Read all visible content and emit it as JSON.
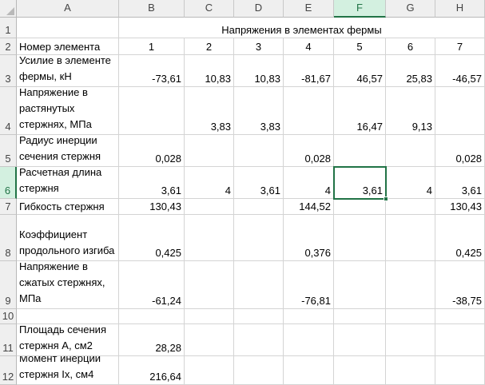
{
  "columns": [
    "A",
    "B",
    "C",
    "D",
    "E",
    "F",
    "G",
    "H"
  ],
  "active_column": "F",
  "active_row": "6",
  "rows": [
    {
      "num": "1",
      "a": "",
      "b": "",
      "c": "",
      "d": "",
      "e": "",
      "f": "",
      "g": "",
      "h": "",
      "merged_title": "Напряжения в элементах фермы"
    },
    {
      "num": "2",
      "a": "Номер элемента",
      "b": "1",
      "c": "2",
      "d": "3",
      "e": "4",
      "f": "5",
      "g": "6",
      "h": "7"
    },
    {
      "num": "3",
      "a": "Усилие в элементе фермы, кН",
      "b": "-73,61",
      "c": "10,83",
      "d": "10,83",
      "e": "-81,67",
      "f": "46,57",
      "g": "25,83",
      "h": "-46,57"
    },
    {
      "num": "4",
      "a": "Напряжение в растянутых стержнях, МПа",
      "b": "",
      "c": "3,83",
      "d": "3,83",
      "e": "",
      "f": "16,47",
      "g": "9,13",
      "h": ""
    },
    {
      "num": "5",
      "a": "Радиус инерции сечения стержня",
      "b": "0,028",
      "c": "",
      "d": "",
      "e": "0,028",
      "f": "",
      "g": "",
      "h": "0,028"
    },
    {
      "num": "6",
      "a": "Расчетная длина стержня",
      "b": "3,61",
      "c": "4",
      "d": "3,61",
      "e": "4",
      "f": "3,61",
      "g": "4",
      "h": "3,61"
    },
    {
      "num": "7",
      "a": "Гибкость стержня",
      "b": "130,43",
      "c": "",
      "d": "",
      "e": "144,52",
      "f": "",
      "g": "",
      "h": "130,43"
    },
    {
      "num": "8",
      "a": "Коэффициент продольного изгиба",
      "b": "0,425",
      "c": "",
      "d": "",
      "e": "0,376",
      "f": "",
      "g": "",
      "h": "0,425"
    },
    {
      "num": "9",
      "a": "Напряжение в сжатых стержнях, МПа",
      "b": "-61,24",
      "c": "",
      "d": "",
      "e": "-76,81",
      "f": "",
      "g": "",
      "h": "-38,75"
    },
    {
      "num": "10",
      "a": "",
      "b": "",
      "c": "",
      "d": "",
      "e": "",
      "f": "",
      "g": "",
      "h": ""
    },
    {
      "num": "11",
      "a": "Площадь сечения стержня А, см2",
      "b": "28,28",
      "c": "",
      "d": "",
      "e": "",
      "f": "",
      "g": "",
      "h": ""
    },
    {
      "num": "12",
      "a": "Момент инерции стержня Ix, см4",
      "b": "216,64",
      "c": "",
      "d": "",
      "e": "",
      "f": "",
      "g": "",
      "h": ""
    }
  ]
}
